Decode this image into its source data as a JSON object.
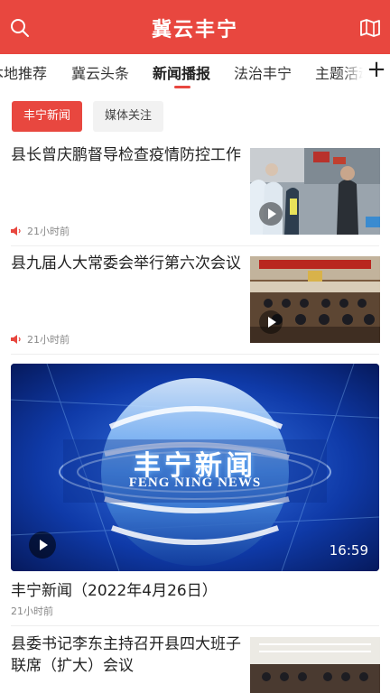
{
  "header": {
    "title": "冀云丰宁"
  },
  "tabs": [
    {
      "label": "本地推荐"
    },
    {
      "label": "冀云头条"
    },
    {
      "label": "新闻播报"
    },
    {
      "label": "法治丰宁"
    },
    {
      "label": "主题活动"
    }
  ],
  "tab_add": "+",
  "chips": [
    {
      "label": "丰宁新闻"
    },
    {
      "label": "媒体关注"
    }
  ],
  "news": [
    {
      "title": "县长曾庆鹏督导检查疫情防控工作",
      "time": "21小时前"
    },
    {
      "title": "县九届人大常委会举行第六次会议",
      "time": "21小时前"
    }
  ],
  "video": {
    "title_cn": "丰宁新闻",
    "title_en": "FENG NING NEWS",
    "duration": "16:59",
    "caption": "丰宁新闻（2022年4月26日）",
    "time": "21小时前"
  },
  "news_last": {
    "title": "县委书记李东主持召开县四大班子联席（扩大）会议"
  },
  "colors": {
    "accent": "#e8473f"
  }
}
